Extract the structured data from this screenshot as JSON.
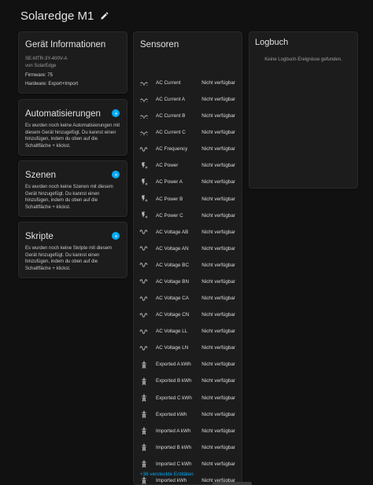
{
  "header": {
    "title": "Solaredge M1"
  },
  "device_info": {
    "title": "Gerät Informationen",
    "model": "SE-MTR-3Y-400V-A",
    "manufacturer": "von SolarEdge",
    "firmware": "Firmware: 75",
    "hardware": "Hardware: Export+Import"
  },
  "automations": {
    "title": "Automatisierungen",
    "description": "Es wurden noch keine Automatisierungen mit diesem Gerät hinzugefügt. Du kannst einen hinzufügen, indem du oben auf die Schaltfläche + klickst."
  },
  "scenes": {
    "title": "Szenen",
    "description": "Es wurden noch keine Szenen mit diesem Gerät hinzugefügt. Du kannst einen hinzufügen, indem du oben auf die Schaltfläche + klickst."
  },
  "scripts": {
    "title": "Skripte",
    "description": "Es wurden noch keine Skripte mit diesem Gerät hinzugefügt. Du kannst einen hinzufügen, indem du oben auf die Schaltfläche + klickst."
  },
  "sensors": {
    "title": "Sensoren",
    "hidden_link": "+36 versteckte Entitäten",
    "items": [
      {
        "name": "AC Current",
        "state": "Nicht verfügbar",
        "icon": "current-ac-icon"
      },
      {
        "name": "AC Current A",
        "state": "Nicht verfügbar",
        "icon": "current-ac-icon"
      },
      {
        "name": "AC Current B",
        "state": "Nicht verfügbar",
        "icon": "current-ac-icon"
      },
      {
        "name": "AC Current C",
        "state": "Nicht verfügbar",
        "icon": "current-ac-icon"
      },
      {
        "name": "AC Frequency",
        "state": "Nicht verfügbar",
        "icon": "sine-wave-icon"
      },
      {
        "name": "AC Power",
        "state": "Nicht verfügbar",
        "icon": "flash-power-icon"
      },
      {
        "name": "AC Power A",
        "state": "Nicht verfügbar",
        "icon": "flash-power-icon"
      },
      {
        "name": "AC Power B",
        "state": "Nicht verfügbar",
        "icon": "flash-power-icon"
      },
      {
        "name": "AC Power C",
        "state": "Nicht verfügbar",
        "icon": "flash-power-icon"
      },
      {
        "name": "AC Voltage AB",
        "state": "Nicht verfügbar",
        "icon": "sine-wave-icon"
      },
      {
        "name": "AC Voltage AN",
        "state": "Nicht verfügbar",
        "icon": "sine-wave-icon"
      },
      {
        "name": "AC Voltage BC",
        "state": "Nicht verfügbar",
        "icon": "sine-wave-icon"
      },
      {
        "name": "AC Voltage BN",
        "state": "Nicht verfügbar",
        "icon": "sine-wave-icon"
      },
      {
        "name": "AC Voltage CA",
        "state": "Nicht verfügbar",
        "icon": "sine-wave-icon"
      },
      {
        "name": "AC Voltage CN",
        "state": "Nicht verfügbar",
        "icon": "sine-wave-icon"
      },
      {
        "name": "AC Voltage LL",
        "state": "Nicht verfügbar",
        "icon": "sine-wave-icon"
      },
      {
        "name": "AC Voltage LN",
        "state": "Nicht verfügbar",
        "icon": "sine-wave-icon"
      },
      {
        "name": "Exported A kWh",
        "state": "Nicht verfügbar",
        "icon": "transmission-tower-icon"
      },
      {
        "name": "Exported B kWh",
        "state": "Nicht verfügbar",
        "icon": "transmission-tower-icon"
      },
      {
        "name": "Exported C kWh",
        "state": "Nicht verfügbar",
        "icon": "transmission-tower-icon"
      },
      {
        "name": "Exported kWh",
        "state": "Nicht verfügbar",
        "icon": "transmission-tower-icon"
      },
      {
        "name": "Imported A kWh",
        "state": "Nicht verfügbar",
        "icon": "transmission-tower-icon"
      },
      {
        "name": "Imported B kWh",
        "state": "Nicht verfügbar",
        "icon": "transmission-tower-icon"
      },
      {
        "name": "Imported C kWh",
        "state": "Nicht verfügbar",
        "icon": "transmission-tower-icon"
      },
      {
        "name": "Imported kWh",
        "state": "Nicht verfügbar",
        "icon": "transmission-tower-icon"
      }
    ]
  },
  "logbook": {
    "title": "Logbuch",
    "empty_text": "Keine Logbuch-Ereignisse gefunden."
  },
  "colors": {
    "background": "#111111",
    "card": "#1c1c1c",
    "accent": "#03a9f4",
    "text": "#e1e1e1",
    "icon": "#bdbdbd"
  }
}
